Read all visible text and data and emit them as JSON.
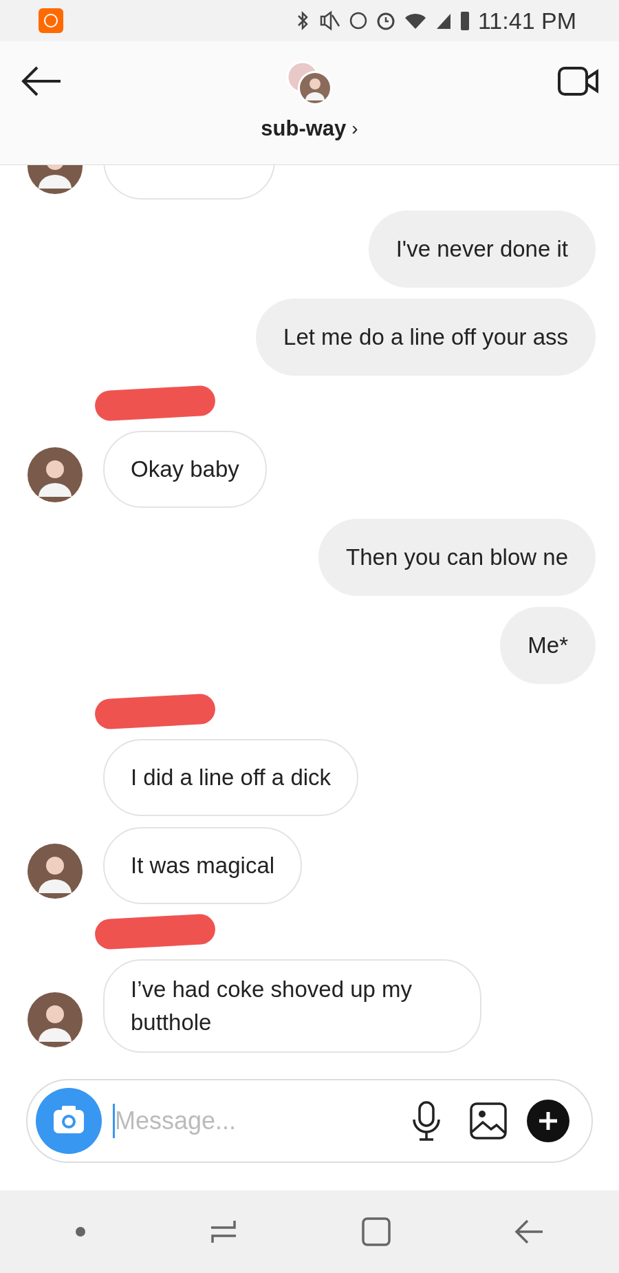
{
  "status_bar": {
    "time": "11:41 PM"
  },
  "header": {
    "title": "sub-way",
    "chevron": "›"
  },
  "messages": [
    {
      "kind": "incoming",
      "avatar": true
    },
    {
      "kind": "outgoing",
      "text": "I've never done it"
    },
    {
      "kind": "outgoing",
      "text": "Let me do a line off your ass"
    },
    {
      "kind": "redaction"
    },
    {
      "kind": "incoming",
      "text": "Okay baby",
      "avatar": true
    },
    {
      "kind": "outgoing",
      "text": "Then you can blow ne"
    },
    {
      "kind": "outgoing",
      "text": "Me*"
    },
    {
      "kind": "redaction"
    },
    {
      "kind": "incoming",
      "text": "I did a line off a dick",
      "avatar": false
    },
    {
      "kind": "incoming",
      "text": "It was magical",
      "avatar": true
    },
    {
      "kind": "redaction"
    },
    {
      "kind": "incoming",
      "text": "I’ve had coke shoved up my butthole",
      "avatar": true
    }
  ],
  "composer": {
    "placeholder": "Message..."
  }
}
